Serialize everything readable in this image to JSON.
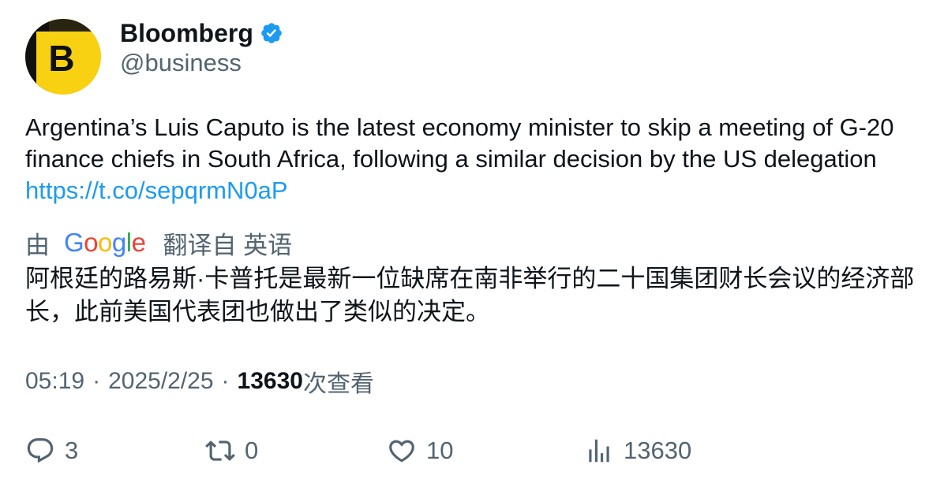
{
  "author": {
    "display_name": "Bloomberg",
    "handle": "@business",
    "avatar_letter": "B",
    "verified": true
  },
  "tweet": {
    "text": "Argentina’s Luis Caputo is the latest economy minister to skip a meeting of G-20 finance chiefs in South Africa, following a similar decision by the US delegation",
    "link": "https://t.co/sepqrmN0aP"
  },
  "translation": {
    "by_label": "由",
    "provider": "Google",
    "from_label": "翻译自 英语",
    "text": "阿根廷的路易斯·卡普托是最新一位缺席在南非举行的二十国集团财长会议的经济部长，此前美国代表团也做出了类似的决定。"
  },
  "meta": {
    "time": "05:19",
    "separator": "·",
    "date": "2025/2/25",
    "views_count": "13630",
    "views_label": "次查看"
  },
  "actions": {
    "replies": "3",
    "retweets": "0",
    "likes": "10",
    "views": "13630"
  },
  "colors": {
    "brand_yellow": "#f7d112",
    "verified_blue": "#1d9bf0",
    "link_blue": "#1d9bf0",
    "secondary_text": "#536471",
    "google_blue": "#4285f4",
    "google_red": "#ea4335",
    "google_yellow": "#fbbc05",
    "google_green": "#34a853"
  },
  "icons": {
    "reply": "reply-icon",
    "retweet": "retweet-icon",
    "like": "like-icon",
    "views": "views-icon",
    "verified": "verified-badge-icon"
  }
}
